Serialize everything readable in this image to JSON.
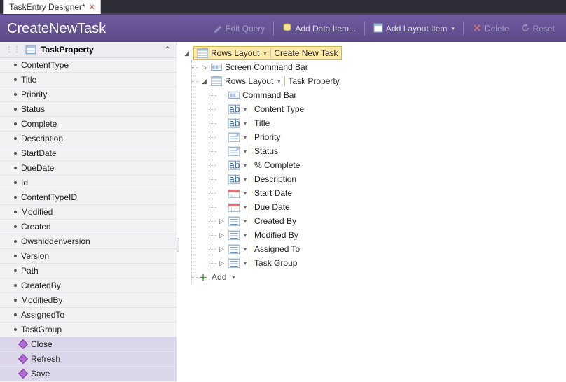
{
  "tab": {
    "title": "TaskEntry Designer*",
    "close": "×"
  },
  "header": {
    "title": "CreateNewTask"
  },
  "toolbar": {
    "editQuery": "Edit Query",
    "addDataItem": "Add Data Item...",
    "addLayoutItem": "Add Layout Item",
    "delete": "Delete",
    "reset": "Reset"
  },
  "sidebar": {
    "header": "TaskProperty",
    "props": [
      "ContentType",
      "Title",
      "Priority",
      "Status",
      "Complete",
      "Description",
      "StartDate",
      "DueDate",
      "Id",
      "ContentTypeID",
      "Modified",
      "Created",
      "Owshiddenversion",
      "Version",
      "Path",
      "CreatedBy",
      "ModifiedBy",
      "AssignedTo",
      "TaskGroup"
    ],
    "methods": [
      "Close",
      "Refresh",
      "Save"
    ]
  },
  "tree": {
    "root": {
      "layout": "Rows Layout",
      "name": "Create New Task"
    },
    "screenCmd": "Screen Command Bar",
    "group": {
      "layout": "Rows Layout",
      "name": "Task Property"
    },
    "cmdBar": "Command Bar",
    "fields": [
      {
        "icon": "text",
        "label": "Content Type"
      },
      {
        "icon": "text",
        "label": "Title"
      },
      {
        "icon": "list",
        "label": "Priority"
      },
      {
        "icon": "list",
        "label": "Status"
      },
      {
        "icon": "text",
        "label": "% Complete"
      },
      {
        "icon": "text",
        "label": "Description"
      },
      {
        "icon": "date",
        "label": "Start Date"
      },
      {
        "icon": "date",
        "label": "Due Date"
      }
    ],
    "relations": [
      {
        "label": "Created By"
      },
      {
        "label": "Modified By"
      },
      {
        "label": "Assigned To"
      },
      {
        "label": "Task Group"
      }
    ],
    "add": "Add"
  }
}
